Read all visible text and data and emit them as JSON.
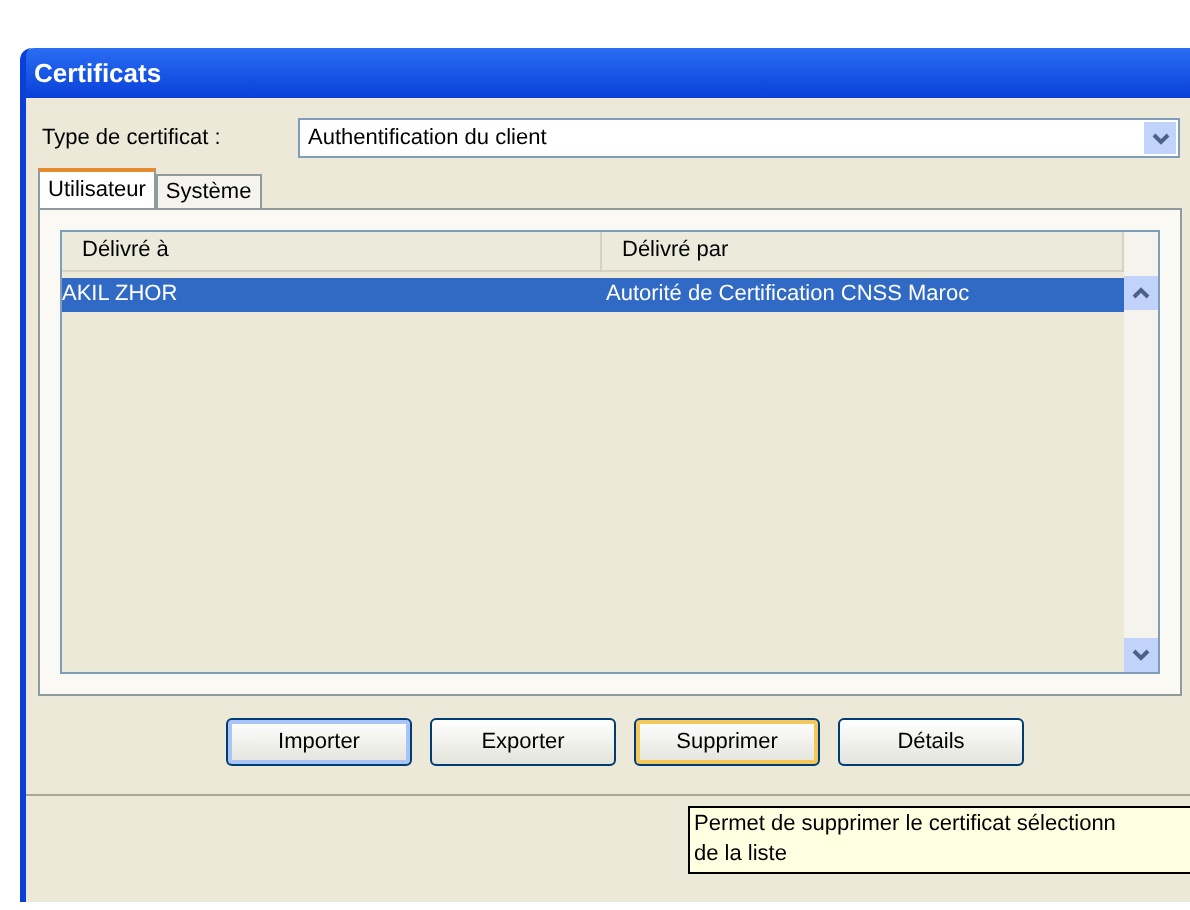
{
  "window": {
    "title": "Certificats"
  },
  "certificate_type": {
    "label": "Type de certificat :",
    "value": "Authentification du client"
  },
  "tabs": [
    {
      "label": "Utilisateur",
      "selected": true
    },
    {
      "label": "Système",
      "selected": false
    }
  ],
  "table": {
    "columns": [
      "Délivré à",
      "Délivré par"
    ],
    "rows": [
      {
        "cells": [
          "AKIL ZHOR",
          "Autorité de Certification CNSS Maroc"
        ],
        "selected": true
      }
    ]
  },
  "buttons": [
    {
      "label": "Importer",
      "focused": true,
      "hovered": false
    },
    {
      "label": "Exporter",
      "focused": false,
      "hovered": false
    },
    {
      "label": "Supprimer",
      "focused": false,
      "hovered": true
    },
    {
      "label": "Détails",
      "focused": false,
      "hovered": false
    }
  ],
  "tooltip": {
    "lines": [
      "Permet de supprimer le certificat sélectionn",
      "de la liste"
    ]
  }
}
